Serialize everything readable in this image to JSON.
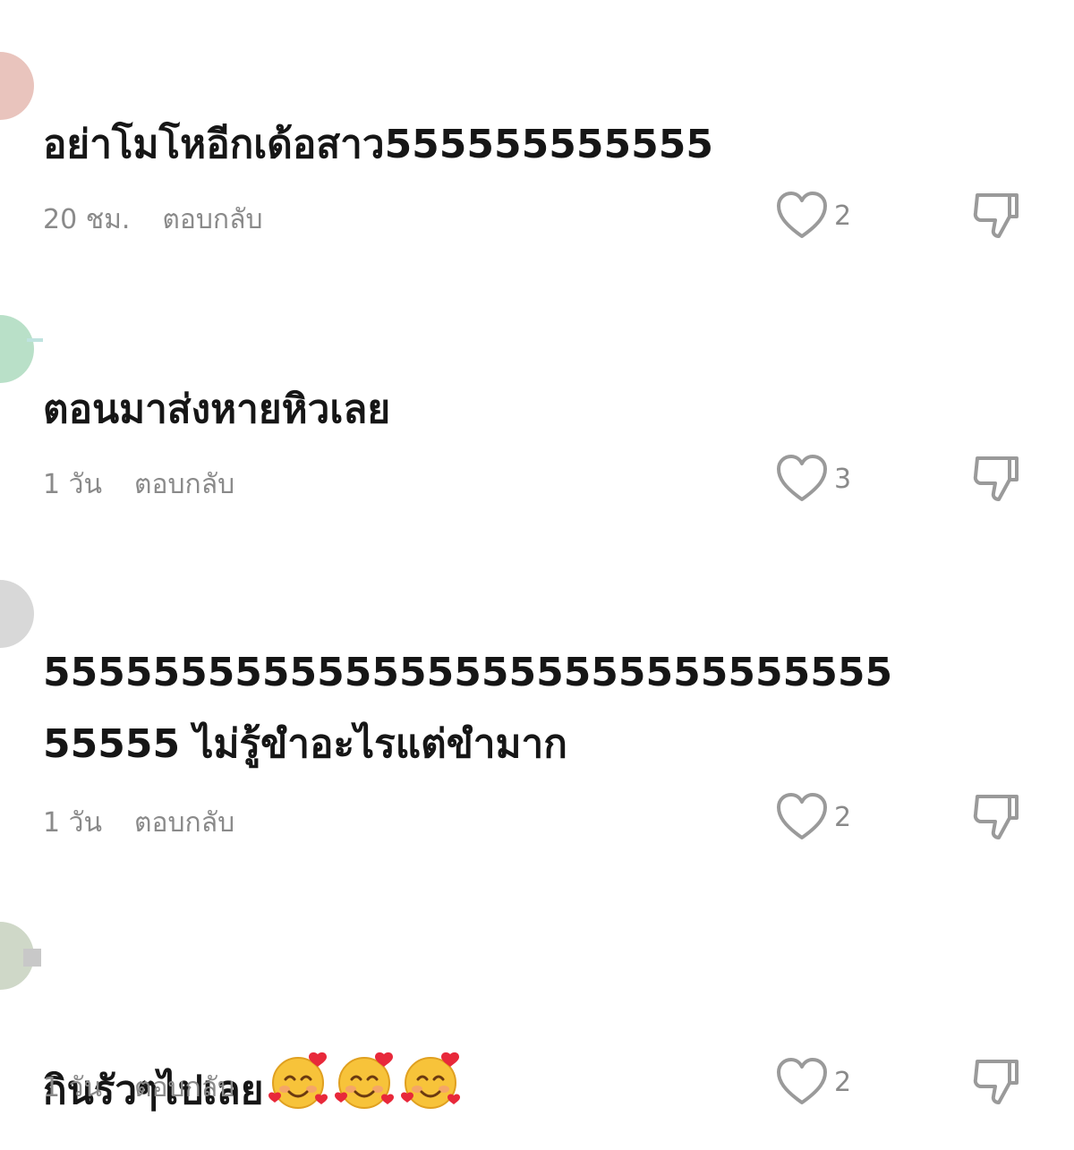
{
  "comments": [
    {
      "text": "อย่าโมโหอีกเด้อสาว555555555555",
      "time": "20 ชม.",
      "reply_label": "ตอบกลับ",
      "likes": "2",
      "avatar_color": "#e9c4bd"
    },
    {
      "text": "ตอนมาส่งหายหิวเลย",
      "time": "1 วัน",
      "reply_label": "ตอบกลับ",
      "likes": "3",
      "avatar_color": "#b9e0c8"
    },
    {
      "text": "5555555555555555555555555555555\n55555 ไม่รู้ขำอะไรแต่ขำมาก",
      "time": "1 วัน",
      "reply_label": "ตอบกลับ",
      "likes": "2",
      "avatar_color": "#d8d8d8"
    },
    {
      "text": "กินรัวๆไปเลย",
      "emoji": "smiling-face-with-hearts",
      "emoji_count": 3,
      "time": "1 วัน",
      "reply_label": "ตอบกลับ",
      "likes": "2",
      "avatar_color": "#cfd8c8"
    }
  ],
  "icons": {
    "like": "heart-outline-icon",
    "dislike": "thumbs-down-outline-icon"
  },
  "colors": {
    "text": "#161616",
    "muted": "#8a8a8a",
    "icon": "#9a9a9a"
  }
}
